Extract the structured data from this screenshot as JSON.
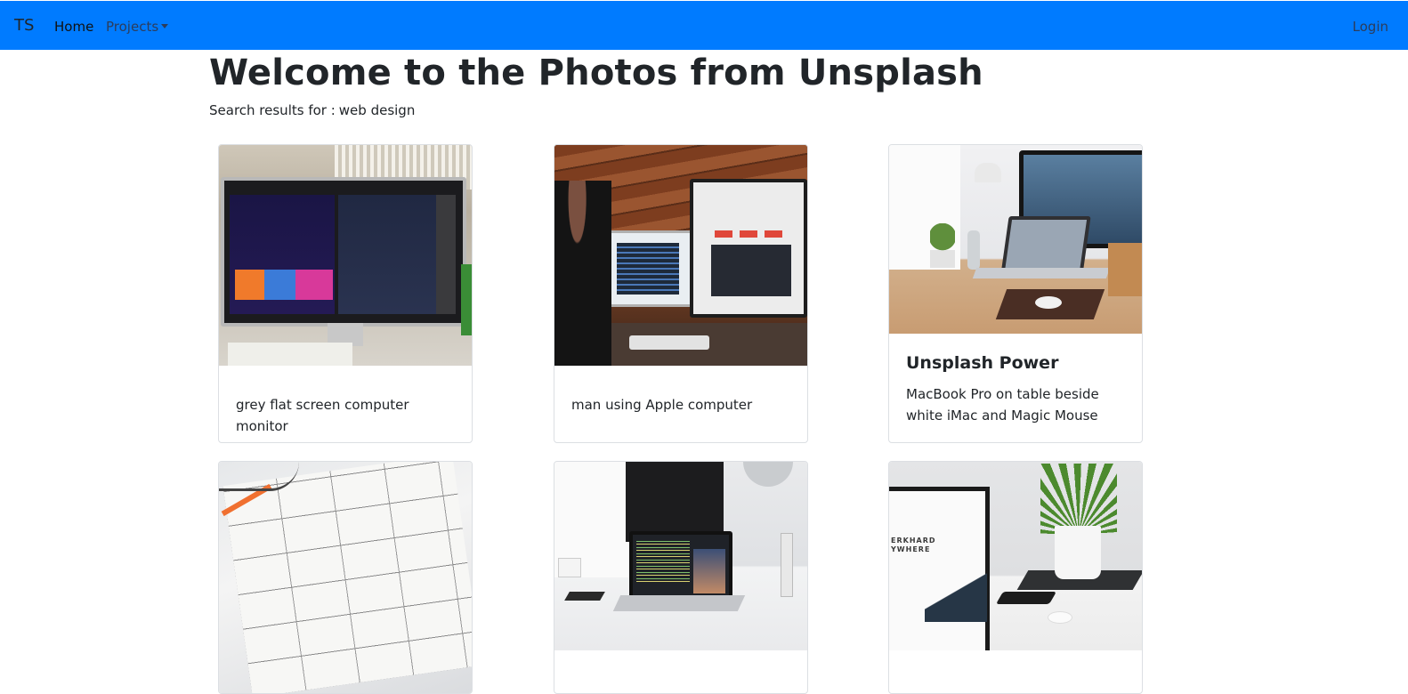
{
  "navbar": {
    "brand": "TS",
    "home_label": "Home",
    "projects_label": "Projects",
    "login_label": "Login",
    "background_color": "#007bff"
  },
  "page": {
    "title": "Welcome to the Photos from Unsplash",
    "search_prefix": "Search results for :",
    "search_query": "web design"
  },
  "cards": [
    {
      "title": "",
      "text": "grey flat screen computer monitor"
    },
    {
      "title": "",
      "text": "man using Apple computer"
    },
    {
      "title": "Unsplash Power",
      "text": "MacBook Pro on table beside white iMac and Magic Mouse"
    },
    {
      "title": "",
      "text": ""
    },
    {
      "title": "",
      "text": ""
    },
    {
      "title": "",
      "text": ""
    }
  ],
  "icons": {
    "projects_dropdown": "caret-down-icon"
  }
}
